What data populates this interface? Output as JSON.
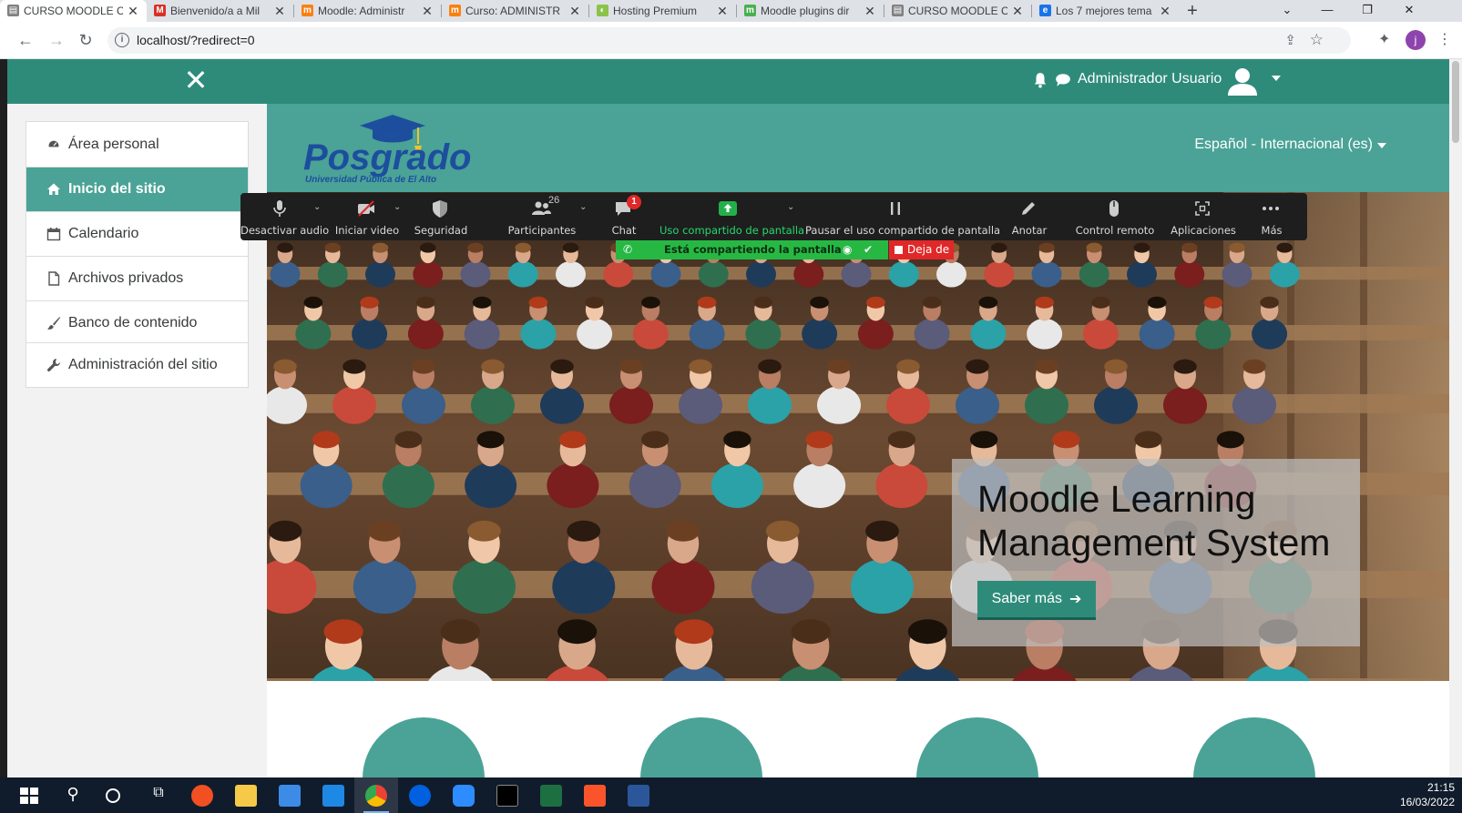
{
  "browser": {
    "tabs": [
      {
        "title": "CURSO MOODLE C",
        "favicon_color": "#808080",
        "favicon_glyph": "▤",
        "active": true
      },
      {
        "title": "Bienvenido/a a Mil",
        "favicon_color": "#d93025",
        "favicon_glyph": "M",
        "active": false
      },
      {
        "title": "Moodle: Administr",
        "favicon_color": "#f98012",
        "favicon_glyph": "m",
        "active": false
      },
      {
        "title": "Curso: ADMINISTR",
        "favicon_color": "#f98012",
        "favicon_glyph": "m",
        "active": false
      },
      {
        "title": "Hosting Premium",
        "favicon_color": "#8bc34a",
        "favicon_glyph": "◐",
        "active": false
      },
      {
        "title": "Moodle plugins dir",
        "favicon_color": "#4caf50",
        "favicon_glyph": "m",
        "active": false
      },
      {
        "title": "CURSO MOODLE C",
        "favicon_color": "#808080",
        "favicon_glyph": "▤",
        "active": false
      },
      {
        "title": "Los 7 mejores tema",
        "favicon_color": "#1a73e8",
        "favicon_glyph": "e",
        "active": false
      }
    ],
    "close_glyph": "✕",
    "new_tab_glyph": "+",
    "url": "localhost/?redirect=0",
    "profile_initial": "j"
  },
  "navbar": {
    "close_glyph": "✕",
    "user_name": "Administrador Usuario"
  },
  "sidebar": {
    "items": [
      {
        "label": "Área personal",
        "icon": "dashboard-icon",
        "active": false
      },
      {
        "label": "Inicio del sitio",
        "icon": "home-icon",
        "active": true
      },
      {
        "label": "Calendario",
        "icon": "calendar-icon",
        "active": false
      },
      {
        "label": "Archivos privados",
        "icon": "file-icon",
        "active": false
      },
      {
        "label": "Banco de contenido",
        "icon": "brush-icon",
        "active": false
      }
    ],
    "admin": {
      "label": "Administración del sitio",
      "icon": "wrench-icon"
    }
  },
  "header": {
    "logo_main": "Posgrado",
    "logo_sub": "Universidad Pública de El Alto",
    "language": "Español - Internacional (es)"
  },
  "hero": {
    "title": "Moodle Learning Management System",
    "button_label": "Saber más",
    "button_arrow": "➔"
  },
  "zoom": {
    "participants_count": "26",
    "chat_badge": "1",
    "items": [
      {
        "label": "Desactivar audio",
        "icon": "microphone-icon"
      },
      {
        "label": "Iniciar video",
        "icon": "video-off-icon"
      },
      {
        "label": "Seguridad",
        "icon": "shield-icon"
      },
      {
        "label": "Participantes",
        "icon": "participants-icon"
      },
      {
        "label": "Chat",
        "icon": "chat-icon"
      },
      {
        "label": "Uso compartido de pantalla",
        "icon": "share-screen-icon"
      },
      {
        "label": "Pausar el uso compartido de pantalla",
        "icon": "pause-icon"
      },
      {
        "label": "Anotar",
        "icon": "pencil-icon"
      },
      {
        "label": "Control remoto",
        "icon": "mouse-icon"
      },
      {
        "label": "Aplicaciones",
        "icon": "apps-icon"
      },
      {
        "label": "Más",
        "icon": "more-icon"
      }
    ],
    "sharing_text": "Está compartiendo la pantalla",
    "stop_label": "Deja de"
  },
  "taskbar": {
    "time": "21:15",
    "date": "16/03/2022"
  },
  "colors": {
    "navbar": "#2e8b7a",
    "header": "#4aa396",
    "active_item": "#4aa396",
    "zoom_green": "#23d96c"
  }
}
